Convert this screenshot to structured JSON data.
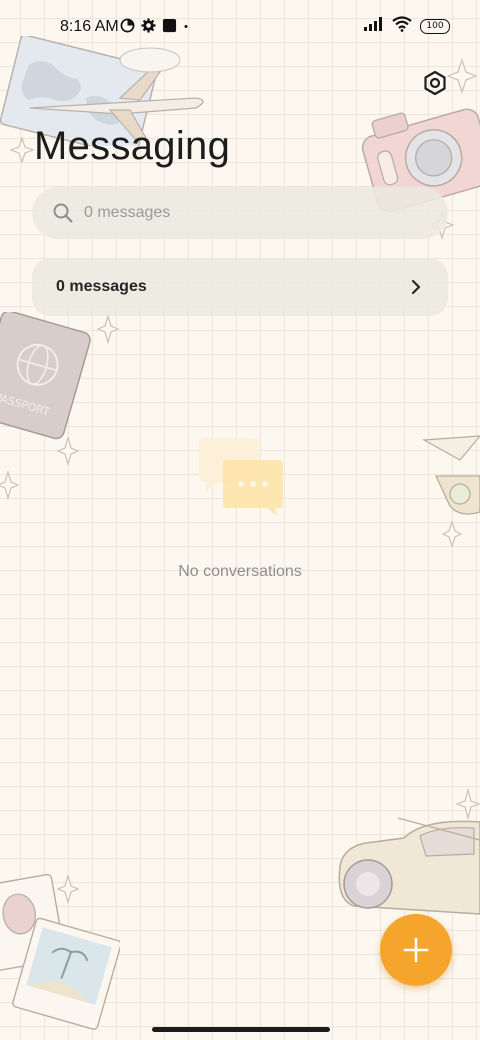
{
  "status_bar": {
    "time": "8:16 AM",
    "left_icons": [
      "data-saver-icon",
      "gear-icon",
      "square-icon",
      "dot-icon"
    ],
    "right_icons": [
      "signal-icon",
      "wifi-icon",
      "battery-icon"
    ],
    "battery_level": "100"
  },
  "header": {
    "title": "Messaging",
    "settings_icon": "settings-hexagon-icon"
  },
  "search": {
    "placeholder": "0 messages",
    "icon": "search-icon"
  },
  "summary": {
    "label": "0 messages",
    "icon": "chevron-right-icon"
  },
  "empty_state": {
    "icon": "chat-bubbles-icon",
    "text": "No conversations"
  },
  "fab": {
    "icon": "plus-icon",
    "color": "#f6a52c"
  },
  "colors": {
    "background": "#fcf8f0",
    "grid_line": "#ece6da",
    "accent": "#f6a52c"
  }
}
